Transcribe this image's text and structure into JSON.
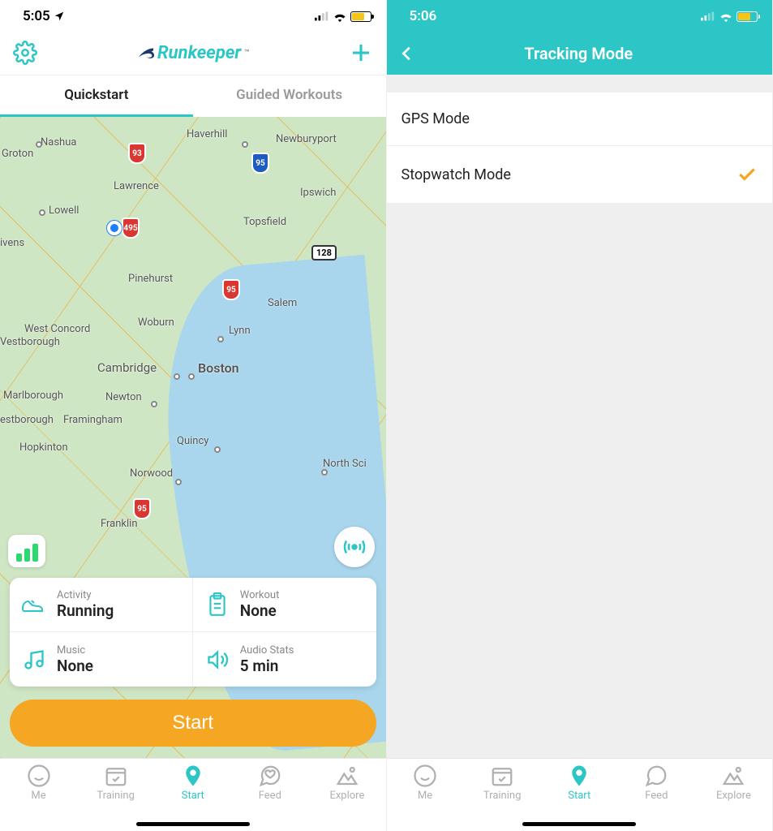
{
  "left": {
    "status_time": "5:05",
    "brand": "Runkeeper",
    "tabs": {
      "quickstart": "Quickstart",
      "guided": "Guided Workouts"
    },
    "map": {
      "cities": [
        "Nashua",
        "Haverhill",
        "Newburyport",
        "Lawrence",
        "Lowell",
        "Ipswich",
        "Topsfield",
        "Pinehurst",
        "Salem",
        "Woburn",
        "Lynn",
        "Cambridge",
        "Boston",
        "Newton",
        "Framingham",
        "Marlborough",
        "Quincy",
        "Norwood",
        "Hopkinton",
        "Franklin",
        "Groton",
        "ivens",
        "Vestborough",
        "West Concord",
        "estborough",
        "North Sci"
      ],
      "hwy_red": [
        "93",
        "495",
        "95",
        "95"
      ],
      "hwy_blue": [
        "95"
      ],
      "route_sign": "128"
    },
    "config": {
      "activity_label": "Activity",
      "activity_value": "Running",
      "workout_label": "Workout",
      "workout_value": "None",
      "music_label": "Music",
      "music_value": "None",
      "audio_label": "Audio Stats",
      "audio_value": "5 min"
    },
    "start_label": "Start"
  },
  "right": {
    "status_time": "5:06",
    "header_title": "Tracking Mode",
    "rows": {
      "gps": "GPS Mode",
      "stopwatch": "Stopwatch Mode"
    }
  },
  "tabbar": {
    "me": "Me",
    "training": "Training",
    "start": "Start",
    "feed": "Feed",
    "explore": "Explore"
  }
}
